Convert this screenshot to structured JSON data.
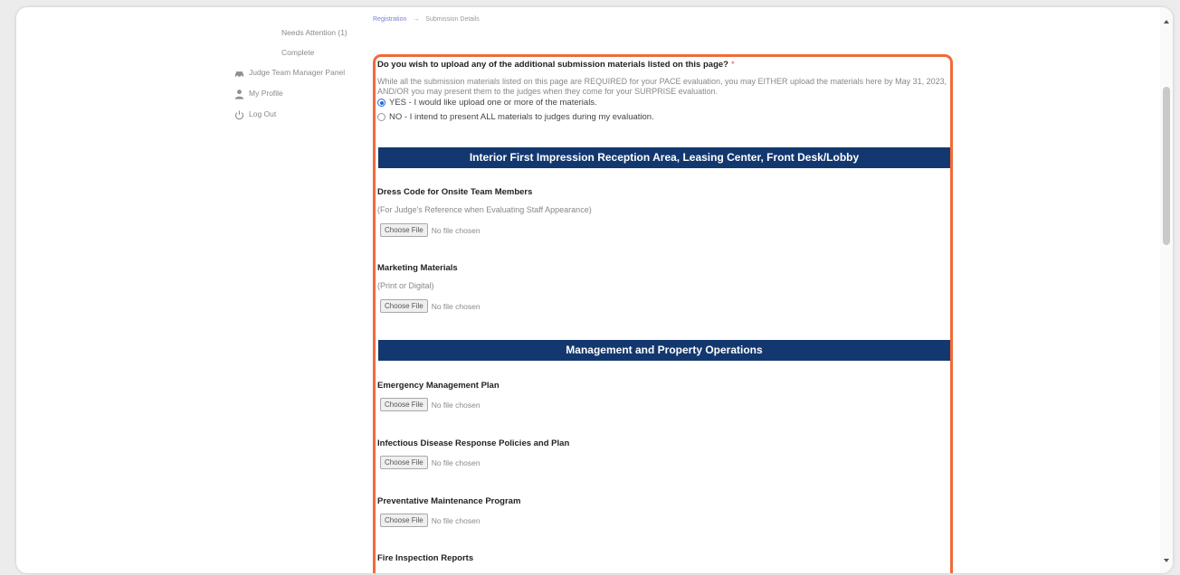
{
  "sidebar": {
    "items": [
      {
        "label": "Needs Attention (1)",
        "icon": ""
      },
      {
        "label": "Complete",
        "icon": ""
      },
      {
        "label": "Judge Team Manager Panel",
        "icon": "car-icon"
      },
      {
        "label": "My Profile",
        "icon": "user-icon"
      },
      {
        "label": "Log Out",
        "icon": "power-icon"
      }
    ]
  },
  "breadcrumb": {
    "link": "Registration",
    "separator": "→",
    "current": "Submission Details"
  },
  "question": {
    "title": "Do you wish to upload any of the additional submission materials listed on this page?",
    "required_mark": "*",
    "description": "While all the submission materials listed on this page are REQUIRED for your PACE evaluation, you may EITHER upload the materials here by May 31, 2023, AND/OR you may present them to the judges when they come for your SURPRISE evaluation.",
    "options": [
      {
        "label": "YES - I would like upload one or more of the materials.",
        "checked": true
      },
      {
        "label": "NO - I intend to present ALL materials to judges during my evaluation.",
        "checked": false
      }
    ]
  },
  "sections": [
    {
      "title": "Interior First Impression Reception Area, Leasing Center, Front Desk/Lobby",
      "fields": [
        {
          "title": "Dress Code for Onsite Team Members",
          "subtitle": "(For Judge's Reference when Evaluating Staff Appearance)"
        },
        {
          "title": "Marketing Materials",
          "subtitle": "(Print or Digital)"
        }
      ]
    },
    {
      "title": "Management and Property Operations",
      "fields": [
        {
          "title": "Emergency Management Plan",
          "subtitle": ""
        },
        {
          "title": "Infectious Disease Response Policies and Plan",
          "subtitle": ""
        },
        {
          "title": "Preventative Maintenance Program",
          "subtitle": ""
        },
        {
          "title": "Fire Inspection Reports",
          "subtitle": ""
        }
      ]
    }
  ],
  "file_input": {
    "button_label": "Choose File",
    "status": "No file chosen"
  },
  "colors": {
    "highlight_border": "#f06b38",
    "section_header_bg": "#13386f",
    "radio_checked": "#2367d6",
    "link": "#7b7fd0"
  }
}
